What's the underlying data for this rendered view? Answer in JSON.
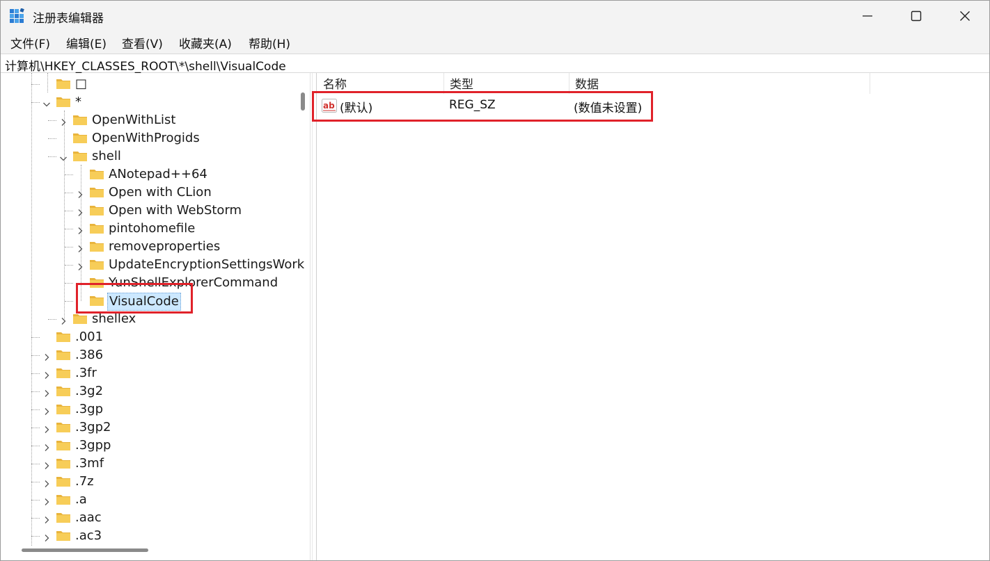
{
  "window": {
    "title": "注册表编辑器",
    "icon": "regedit-icon"
  },
  "menu": [
    {
      "label": "文件(F)"
    },
    {
      "label": "编辑(E)"
    },
    {
      "label": "查看(V)"
    },
    {
      "label": "收藏夹(A)"
    },
    {
      "label": "帮助(H)"
    }
  ],
  "address": {
    "path": "计算机\\HKEY_CLASSES_ROOT\\*\\shell\\VisualCode"
  },
  "tree": {
    "items": [
      {
        "label": "□",
        "expander": "none"
      },
      {
        "label": "*",
        "expander": "expanded"
      },
      {
        "label": "OpenWithList",
        "expander": "collapsed"
      },
      {
        "label": "OpenWithProgids",
        "expander": "none"
      },
      {
        "label": "shell",
        "expander": "expanded"
      },
      {
        "label": "ANotepad++64",
        "expander": "none"
      },
      {
        "label": "Open with CLion",
        "expander": "collapsed"
      },
      {
        "label": "Open with WebStorm",
        "expander": "collapsed"
      },
      {
        "label": "pintohomefile",
        "expander": "collapsed"
      },
      {
        "label": "removeproperties",
        "expander": "collapsed"
      },
      {
        "label": "UpdateEncryptionSettingsWork",
        "expander": "collapsed"
      },
      {
        "label": "YunShellExplorerCommand",
        "expander": "none"
      },
      {
        "label": "VisualCode",
        "expander": "none",
        "selected": true
      },
      {
        "label": "shellex",
        "expander": "collapsed"
      },
      {
        "label": ".001",
        "expander": "none"
      },
      {
        "label": ".386",
        "expander": "collapsed"
      },
      {
        "label": ".3fr",
        "expander": "collapsed"
      },
      {
        "label": ".3g2",
        "expander": "collapsed"
      },
      {
        "label": ".3gp",
        "expander": "collapsed"
      },
      {
        "label": ".3gp2",
        "expander": "collapsed"
      },
      {
        "label": ".3gpp",
        "expander": "collapsed"
      },
      {
        "label": ".3mf",
        "expander": "collapsed"
      },
      {
        "label": ".7z",
        "expander": "collapsed"
      },
      {
        "label": ".a",
        "expander": "collapsed"
      },
      {
        "label": ".aac",
        "expander": "collapsed"
      },
      {
        "label": ".ac3",
        "expander": "collapsed"
      }
    ]
  },
  "list": {
    "columns": [
      "名称",
      "类型",
      "数据"
    ],
    "rows": [
      {
        "name": "(默认)",
        "type": "REG_SZ",
        "data": "(数值未设置)",
        "icon": "string-value-icon"
      }
    ]
  },
  "colors": {
    "annotation": "#e0222a",
    "selection": "#cce8ff",
    "folder": "#f5c64a"
  }
}
